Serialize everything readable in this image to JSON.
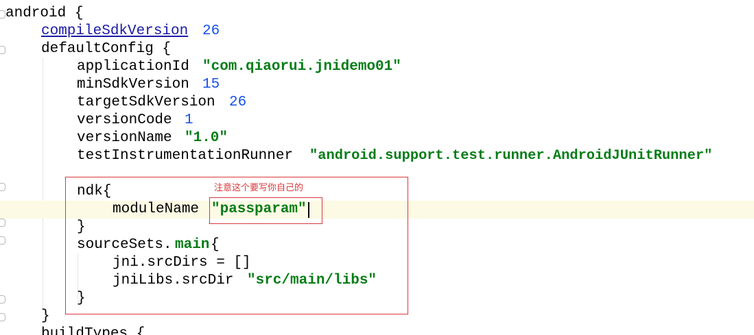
{
  "code": {
    "android": "android {",
    "compileSdkVersion_key": "compileSdkVersion",
    "compileSdkVersion_val": "26",
    "defaultConfig": "defaultConfig {",
    "applicationId_key": "applicationId ",
    "applicationId_val": "\"com.qiaorui.jnidemo01\"",
    "minSdkVersion_key": "minSdkVersion ",
    "minSdkVersion_val": "15",
    "targetSdkVersion_key": "targetSdkVersion ",
    "targetSdkVersion_val": "26",
    "versionCode_key": "versionCode ",
    "versionCode_val": "1",
    "versionName_key": "versionName ",
    "versionName_val": "\"1.0\"",
    "runner_key": "testInstrumentationRunner ",
    "runner_val": "\"android.support.test.runner.AndroidJUnitRunner\"",
    "ndk_open": "ndk{",
    "moduleName_key": "moduleName ",
    "moduleName_val": "\"passparam\"",
    "ndk_close": "}",
    "sourceSets_key": "sourceSets.",
    "sourceSets_main": "main",
    "sourceSets_brace": "{",
    "jni_srcDirs": "jni.srcDirs = []",
    "jniLibs_key": "jniLibs.srcDir ",
    "jniLibs_val": "\"src/main/libs\"",
    "sourceSets_close": "}",
    "defaultConfig_close": "}",
    "buildTypes": "buildTypes {"
  },
  "annotation": {
    "note": "注意这个要写你自己的"
  },
  "colors": {
    "string": "#067d17",
    "number": "#1750eb",
    "link": "#1a1aa6",
    "annotation": "#d9383a",
    "current_line": "#fcfae4"
  }
}
